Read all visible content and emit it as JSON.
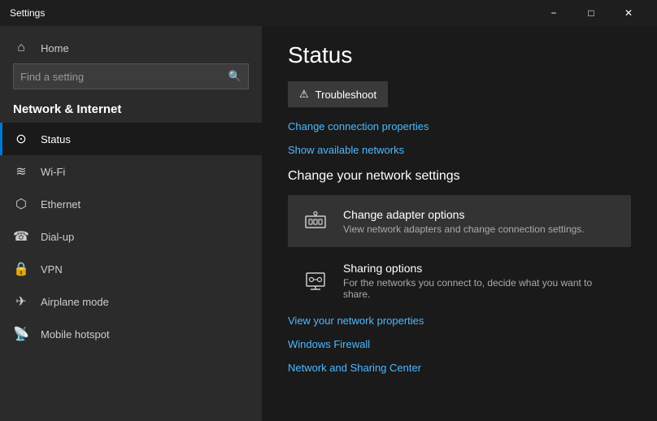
{
  "titlebar": {
    "title": "Settings",
    "minimize_label": "−",
    "maximize_label": "□",
    "close_label": "✕"
  },
  "sidebar": {
    "home_label": "Home",
    "search_placeholder": "Find a setting",
    "section_label": "Network & Internet",
    "items": [
      {
        "id": "status",
        "label": "Status",
        "icon": "⊙",
        "active": true
      },
      {
        "id": "wifi",
        "label": "Wi-Fi",
        "icon": "📶"
      },
      {
        "id": "ethernet",
        "label": "Ethernet",
        "icon": "🔌"
      },
      {
        "id": "dialup",
        "label": "Dial-up",
        "icon": "☎"
      },
      {
        "id": "vpn",
        "label": "VPN",
        "icon": "🔒"
      },
      {
        "id": "airplane",
        "label": "Airplane mode",
        "icon": "✈"
      },
      {
        "id": "hotspot",
        "label": "Mobile hotspot",
        "icon": "📡"
      }
    ]
  },
  "content": {
    "page_title": "Status",
    "troubleshoot_label": "⚠ Troubleshoot",
    "change_connection_label": "Change connection properties",
    "show_networks_label": "Show available networks",
    "network_settings_heading": "Change your network settings",
    "adapter_title": "Change adapter options",
    "adapter_desc": "View network adapters and change connection settings.",
    "sharing_title": "Sharing options",
    "sharing_desc": "For the networks you connect to, decide what you want to share.",
    "network_properties_label": "View your network properties",
    "firewall_label": "Windows Firewall",
    "sharing_center_label": "Network and Sharing Center"
  },
  "icons": {
    "adapter": "⊞",
    "sharing": "⊡",
    "search": "🔍",
    "home": "⌂",
    "wifi": "≋",
    "ethernet": "⬡",
    "dialup": "☎",
    "vpn": "⬡",
    "airplane": "✈",
    "hotspot": "◉"
  }
}
